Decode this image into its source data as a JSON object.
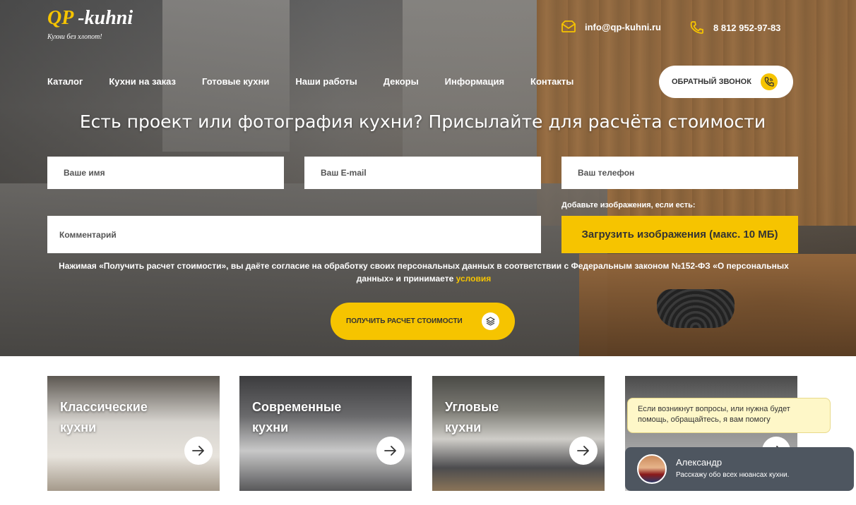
{
  "brand": {
    "logo_qp": "QP",
    "logo_rest": " -kuhni",
    "tagline": "Кухни без хлопот!"
  },
  "header": {
    "email": "info@qp-kuhni.ru",
    "phone": "8 812 952-97-83",
    "callback_label": "ОБРАТНЫЙ ЗВОНОК"
  },
  "nav": {
    "items": [
      "Каталог",
      "Кухни на заказ",
      "Готовые кухни",
      "Наши работы",
      "Декоры",
      "Информация",
      "Контакты"
    ]
  },
  "hero": {
    "headline": "Есть проект или фотография кухни? Присылайте для расчёта стоимости"
  },
  "form": {
    "name_placeholder": "Ваше имя",
    "email_placeholder": "Ваш E-mail",
    "phone_placeholder": "Ваш телефон",
    "comment_placeholder": "Комментарий",
    "images_label": "Добавьте изображения, если есть:",
    "upload_button": "Загрузить изображения (макс. 10 МБ)",
    "consent_text": "Нажимая «Получить расчет стоимости», вы даёте согласие на обработку своих персональных данных в соответствии с Федеральным законом №152-ФЗ «О персональных данных» и принимаете ",
    "consent_link": "условия",
    "submit_label": "ПОЛУЧИТЬ РАСЧЕТ СТОИМОСТИ"
  },
  "categories": [
    {
      "line1": "Классические",
      "line2": "кухни"
    },
    {
      "line1": "Современные",
      "line2": "кухни"
    },
    {
      "line1": "Угловые",
      "line2": "кухни"
    },
    {
      "line1": "",
      "line2": ""
    }
  ],
  "chat": {
    "tooltip": "Если возникнут вопросы, или нужна будет помощь, обращайтесь, я вам помогу",
    "agent_name": "Александр",
    "agent_subtitle": "Расскажу обо всех нюансах кухни."
  },
  "colors": {
    "accent": "#f6c400",
    "chat_bg": "#4e5660",
    "tooltip_bg": "#fef7c8"
  },
  "icons": {
    "email": "envelope-icon",
    "phone": "phone-icon",
    "callback": "phone-call-icon",
    "submit": "layers-icon",
    "card_arrow": "arrow-right-icon"
  }
}
